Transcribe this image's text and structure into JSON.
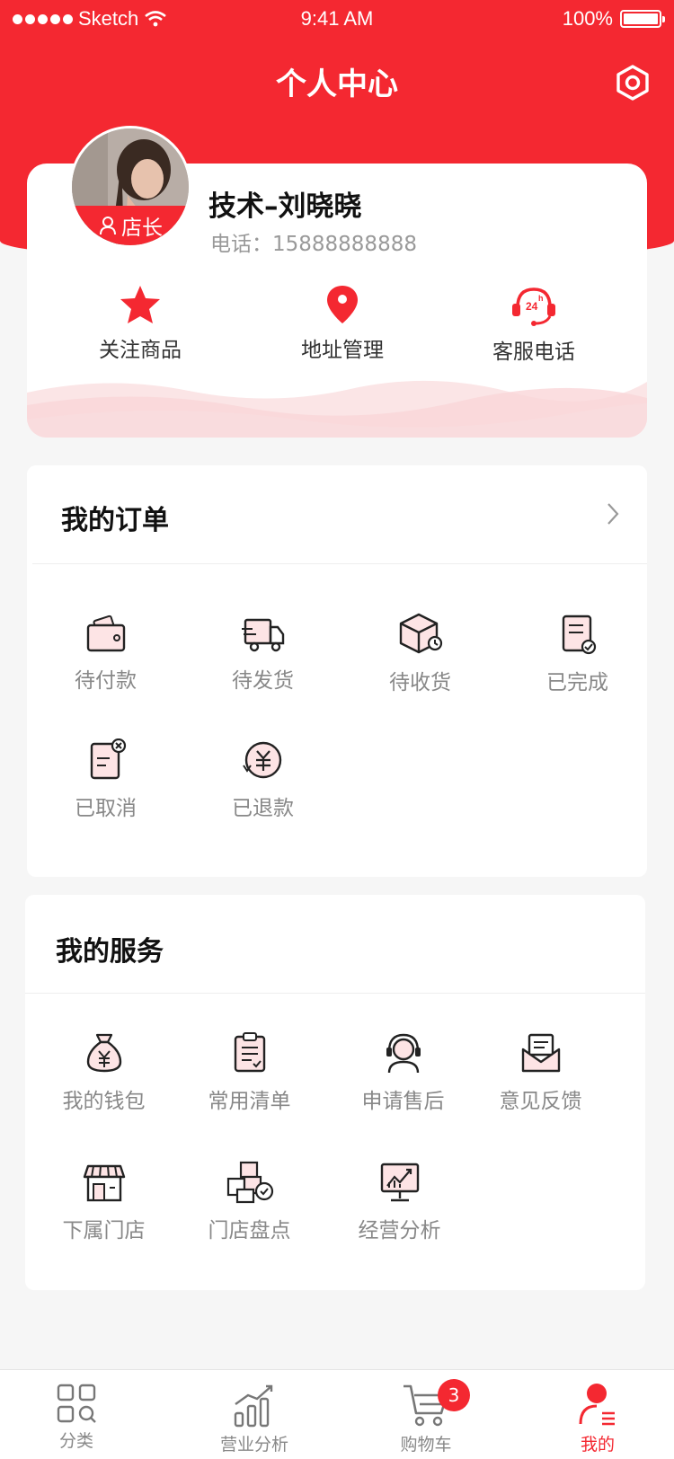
{
  "status_bar": {
    "carrier": "Sketch",
    "time": "9:41 AM",
    "battery": "100%"
  },
  "nav": {
    "title": "个人中心",
    "settings_icon": "settings-icon"
  },
  "profile": {
    "name": "技术–刘晓晓",
    "phone": "电话：15888888888",
    "role_badge": "店长"
  },
  "quick_actions": [
    {
      "label": "关注商品",
      "icon": "star-icon"
    },
    {
      "label": "地址管理",
      "icon": "location-pin-icon"
    },
    {
      "label": "客服电话",
      "icon": "headset-24h-icon"
    }
  ],
  "orders": {
    "title": "我的订单",
    "items": [
      {
        "label": "待付款",
        "icon": "wallet-icon"
      },
      {
        "label": "待发货",
        "icon": "delivery-truck-icon"
      },
      {
        "label": "待收货",
        "icon": "package-icon"
      },
      {
        "label": "已完成",
        "icon": "completed-document-icon"
      },
      {
        "label": "已取消",
        "icon": "cancelled-document-icon"
      },
      {
        "label": "已退款",
        "icon": "refund-icon"
      }
    ]
  },
  "services": {
    "title": "我的服务",
    "items": [
      {
        "label": "我的钱包",
        "icon": "money-bag-icon"
      },
      {
        "label": "常用清单",
        "icon": "clipboard-list-icon"
      },
      {
        "label": "申请售后",
        "icon": "customer-service-icon"
      },
      {
        "label": "意见反馈",
        "icon": "feedback-mail-icon"
      },
      {
        "label": "下属门店",
        "icon": "store-icon"
      },
      {
        "label": "门店盘点",
        "icon": "inventory-boxes-icon"
      },
      {
        "label": "经营分析",
        "icon": "analysis-board-icon"
      }
    ]
  },
  "tabbar": {
    "items": [
      {
        "label": "分类",
        "icon": "category-grid-icon"
      },
      {
        "label": "营业分析",
        "icon": "bar-chart-icon"
      },
      {
        "label": "购物车",
        "icon": "cart-icon",
        "badge": "3"
      },
      {
        "label": "我的",
        "icon": "user-profile-icon",
        "active": true
      }
    ]
  },
  "colors": {
    "primary": "#f42831",
    "background": "#f6f6f6"
  }
}
